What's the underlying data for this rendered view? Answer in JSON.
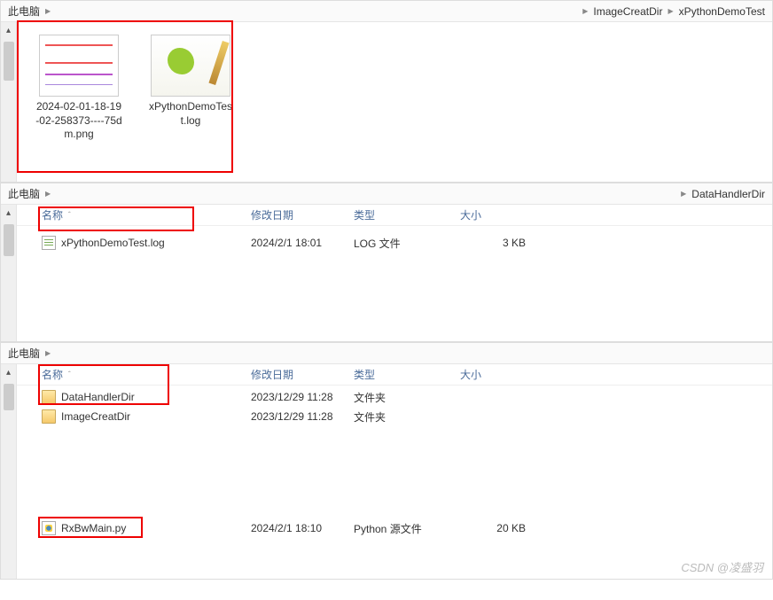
{
  "panel1": {
    "breadcrumb": {
      "root": "此电脑",
      "path": [
        "ImageCreatDir",
        "xPythonDemoTest"
      ]
    },
    "files": [
      {
        "name": "2024-02-01-18-19-02-258373----75dm.png"
      },
      {
        "name": "xPythonDemoTest.log"
      }
    ]
  },
  "panel2": {
    "breadcrumb": {
      "root": "此电脑",
      "path": [
        "DataHandlerDir"
      ]
    },
    "columns": {
      "name": "名称",
      "date": "修改日期",
      "type": "类型",
      "size": "大小"
    },
    "rows": [
      {
        "name": "xPythonDemoTest.log",
        "date": "2024/2/1 18:01",
        "type": "LOG 文件",
        "size": "3 KB",
        "icon": "log"
      }
    ]
  },
  "panel3": {
    "breadcrumb": {
      "root": "此电脑"
    },
    "columns": {
      "name": "名称",
      "date": "修改日期",
      "type": "类型",
      "size": "大小"
    },
    "rows": [
      {
        "name": "DataHandlerDir",
        "date": "2023/12/29 11:28",
        "type": "文件夹",
        "size": "",
        "icon": "folder"
      },
      {
        "name": "ImageCreatDir",
        "date": "2023/12/29 11:28",
        "type": "文件夹",
        "size": "",
        "icon": "folder"
      },
      {
        "name": "RxBwMain.py",
        "date": "2024/2/1 18:10",
        "type": "Python 源文件",
        "size": "20 KB",
        "icon": "py"
      }
    ]
  },
  "watermark": "CSDN @凌盛羽"
}
